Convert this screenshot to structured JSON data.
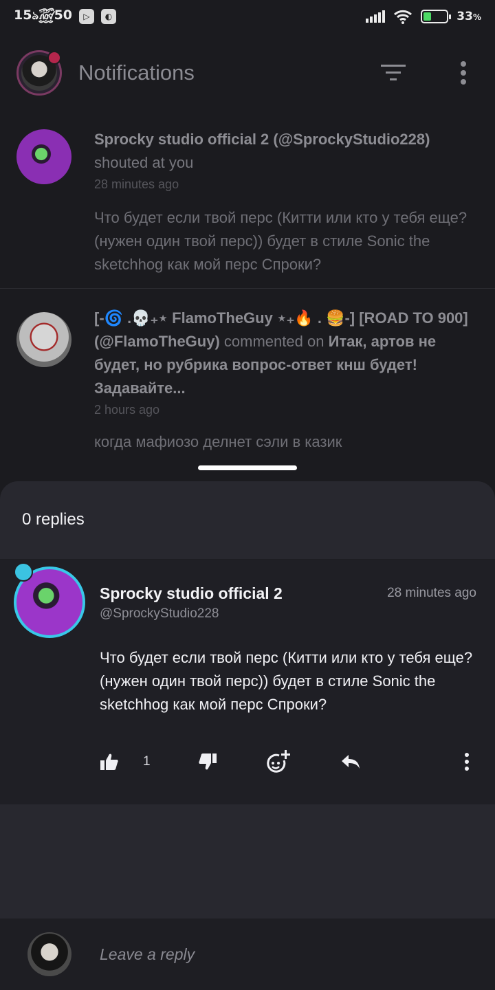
{
  "status_bar": {
    "time": "15",
    "time_rest": "50",
    "battery_percent": "33",
    "battery_unit": "%",
    "battery_level": 0.33,
    "accent": "#4cd964"
  },
  "header": {
    "title": "Notifications",
    "icons": [
      "filter-icon",
      "more-vert-icon"
    ]
  },
  "notifications": [
    {
      "name": "Sprocky studio official 2",
      "handle": "(@SprockyStudio228)",
      "action": "shouted at you",
      "time": "28 minutes ago",
      "body": "Что будет если твой перс (Китти или кто у тебя еще? (нужен один твой перс)) будет в стиле Sonic the sketchhog как мой перс Спроки?"
    },
    {
      "name": "[-🌀 .💀₊⋆ FlamoTheGuy ⋆₊🔥 . 🍔-] [ROAD TO 900]",
      "handle": "(@FlamoTheGuy)",
      "action": "commented on",
      "target": "Итак, артов не будет, но рубрика вопрос-ответ кнш будет! Задавайте...",
      "time": "2 hours ago",
      "body": "когда мафиозо делнет сэли в казик"
    }
  ],
  "sheet": {
    "replies_label": "0 replies",
    "comment": {
      "name": "Sprocky studio official 2",
      "handle": "@SprockyStudio228",
      "time": "28 minutes ago",
      "body": "Что будет если твой перс (Китти или кто у тебя еще? (нужен один твой перс)) будет в стиле Sonic the sketchhog как мой перс Спроки?",
      "likes": "1"
    },
    "reply_placeholder": "Leave a reply"
  },
  "colors": {
    "background": "#1b1b1f",
    "sheet": "#28282f",
    "comment_bg": "#1f1f25",
    "notif_dot": "#b4264c",
    "avatar_ring": "#39c8e8"
  }
}
